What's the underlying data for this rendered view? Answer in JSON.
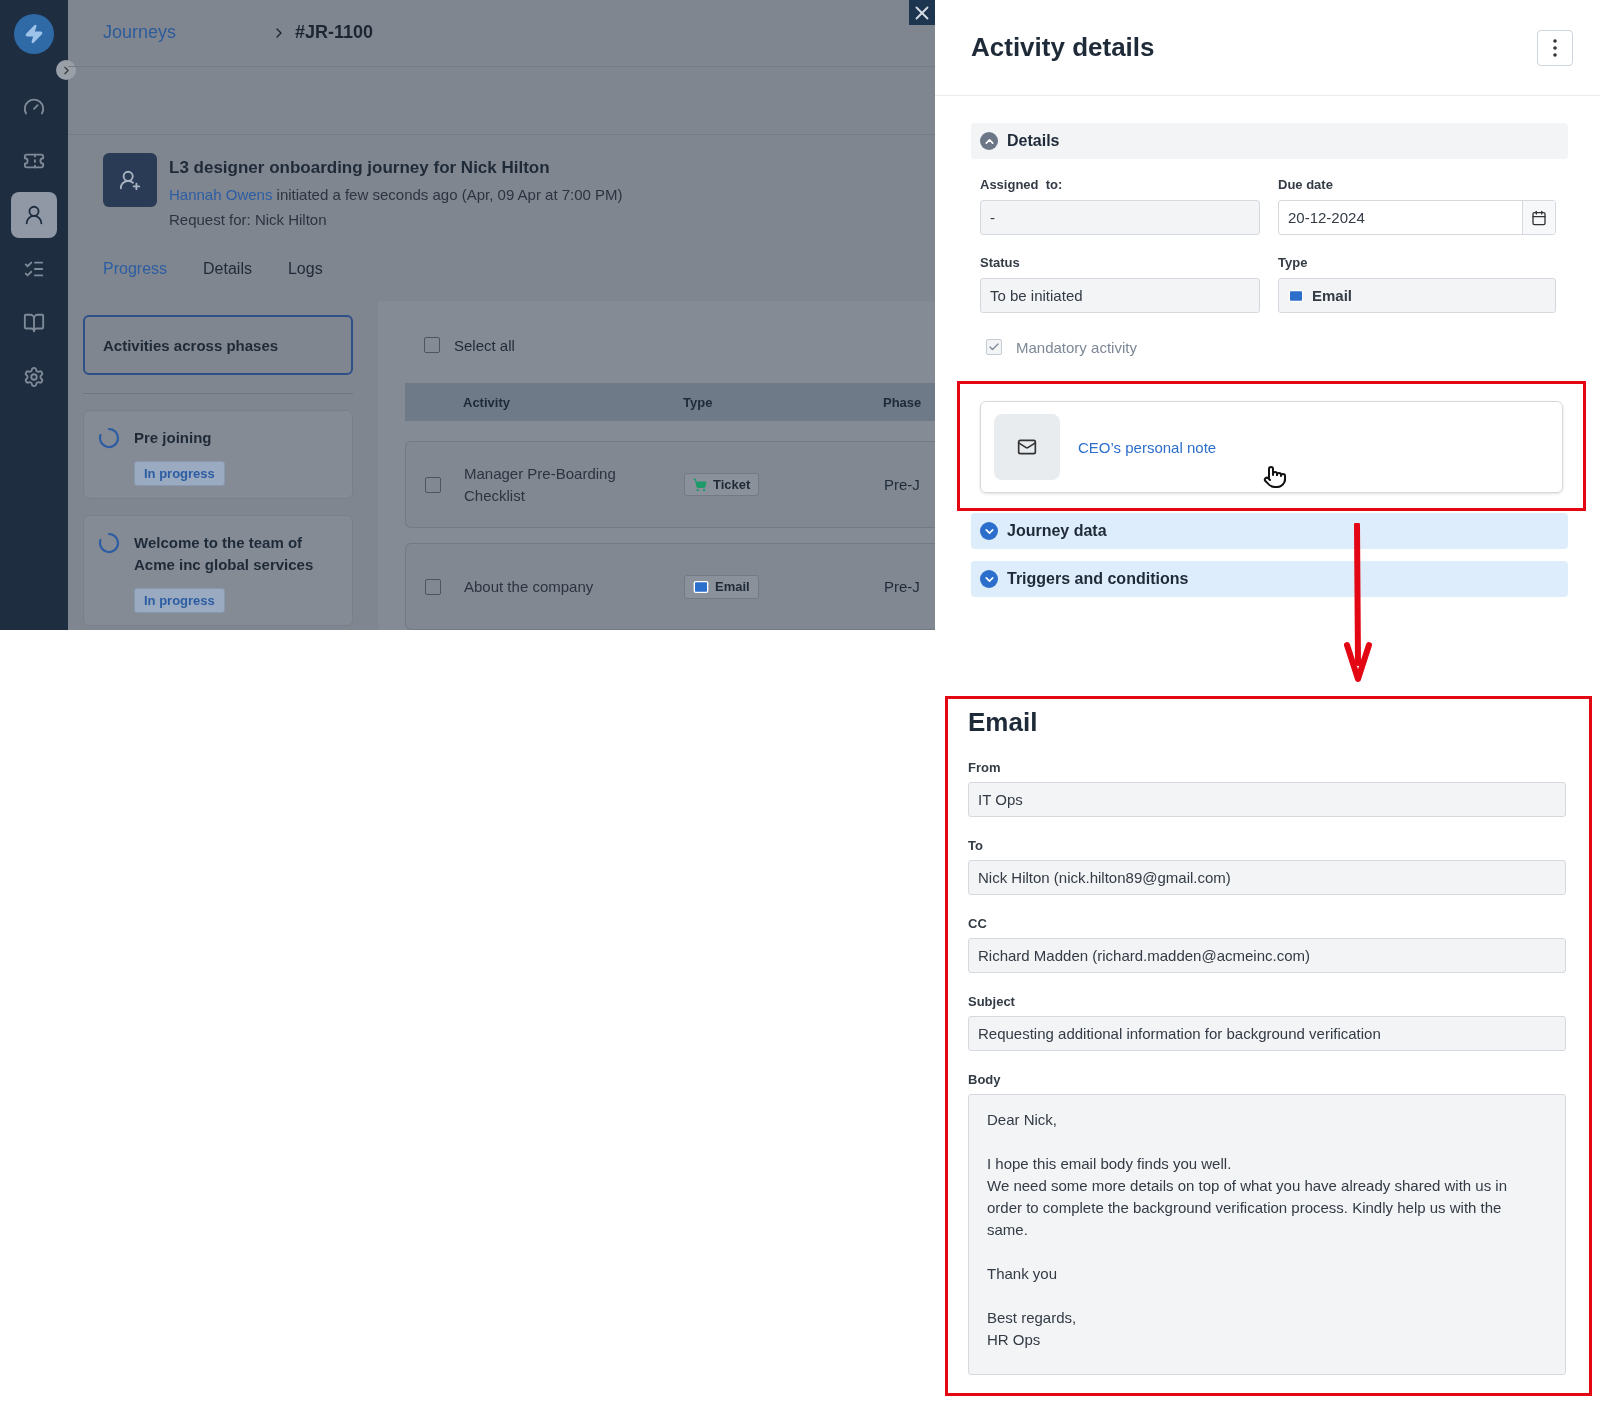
{
  "sidebar": {
    "items": [
      {
        "selected": false
      },
      {
        "selected": false
      },
      {
        "selected": true
      },
      {
        "selected": false
      },
      {
        "selected": false
      },
      {
        "selected": false
      }
    ]
  },
  "breadcrumb": [
    {
      "label": "Journeys",
      "kind": "link"
    },
    {
      "label": "#JR-1100",
      "kind": "current"
    }
  ],
  "journey": {
    "title": "L3 designer onboarding journey for Nick Hilton",
    "initiator": "Hannah Owens",
    "initiated": "initiated a few seconds ago (Apr, 09 Apr at 7:00 PM)",
    "request_for": "Request for: Nick Hilton"
  },
  "tabs": [
    {
      "label": "Progress",
      "selected": true
    },
    {
      "label": "Details",
      "selected": false
    },
    {
      "label": "Logs",
      "selected": false
    }
  ],
  "phases": {
    "header": "Activities across phases",
    "items": [
      {
        "name": "Pre joining",
        "status": "In progress"
      },
      {
        "name": "Welcome to the team of Acme inc global services",
        "status": "In progress"
      }
    ]
  },
  "activities": {
    "select_all": {
      "label": "Select all",
      "checked": false
    },
    "columns": [
      "Activity",
      "Type",
      "Phase"
    ],
    "rows": [
      {
        "checked": false,
        "activity": "Manager Pre-Boarding Checklist",
        "type": {
          "kind": "ticket",
          "label": "Ticket"
        },
        "phase": "Pre-J"
      },
      {
        "checked": false,
        "activity": "About the company",
        "type": {
          "kind": "email",
          "label": "Email"
        },
        "phase": "Pre-J"
      }
    ]
  },
  "activity_details": {
    "title": "Activity details",
    "details": {
      "title": "Details",
      "expanded": true,
      "fields": [
        {
          "label": "Assigned  to:",
          "value": "-",
          "kind": "text"
        },
        {
          "label": "Due date",
          "value": "20-12-2024",
          "kind": "date"
        },
        {
          "label": "Status",
          "value": "To be initiated",
          "kind": "text"
        },
        {
          "label": "Type",
          "value": "Email",
          "kind": "type"
        }
      ],
      "mandatory": {
        "label": "Mandatory activity",
        "checked": true,
        "disabled": true
      },
      "linked_activity": "CEO’s personal note"
    },
    "other_sections": [
      {
        "title": "Journey data",
        "expanded": false
      },
      {
        "title": "Triggers and conditions",
        "expanded": false
      }
    ]
  },
  "email": {
    "title": "Email",
    "fields": [
      {
        "label": "From",
        "value": "IT Ops"
      },
      {
        "label": "To",
        "value": "Nick Hilton (nick.hilton89@gmail.com)"
      },
      {
        "label": "CC",
        "value": "Richard Madden (richard.madden@acmeinc.com)"
      },
      {
        "label": "Subject",
        "value": "Requesting additional information for background verification"
      }
    ],
    "body": {
      "label": "Body",
      "paragraphs": [
        "Dear Nick,",
        "I hope this email body finds you well.\nWe need some more details on top of what you have already shared with us in order to complete the background verification process. Kindly help us with the same.",
        "Thank you",
        "Best regards,\nHR Ops"
      ]
    }
  }
}
